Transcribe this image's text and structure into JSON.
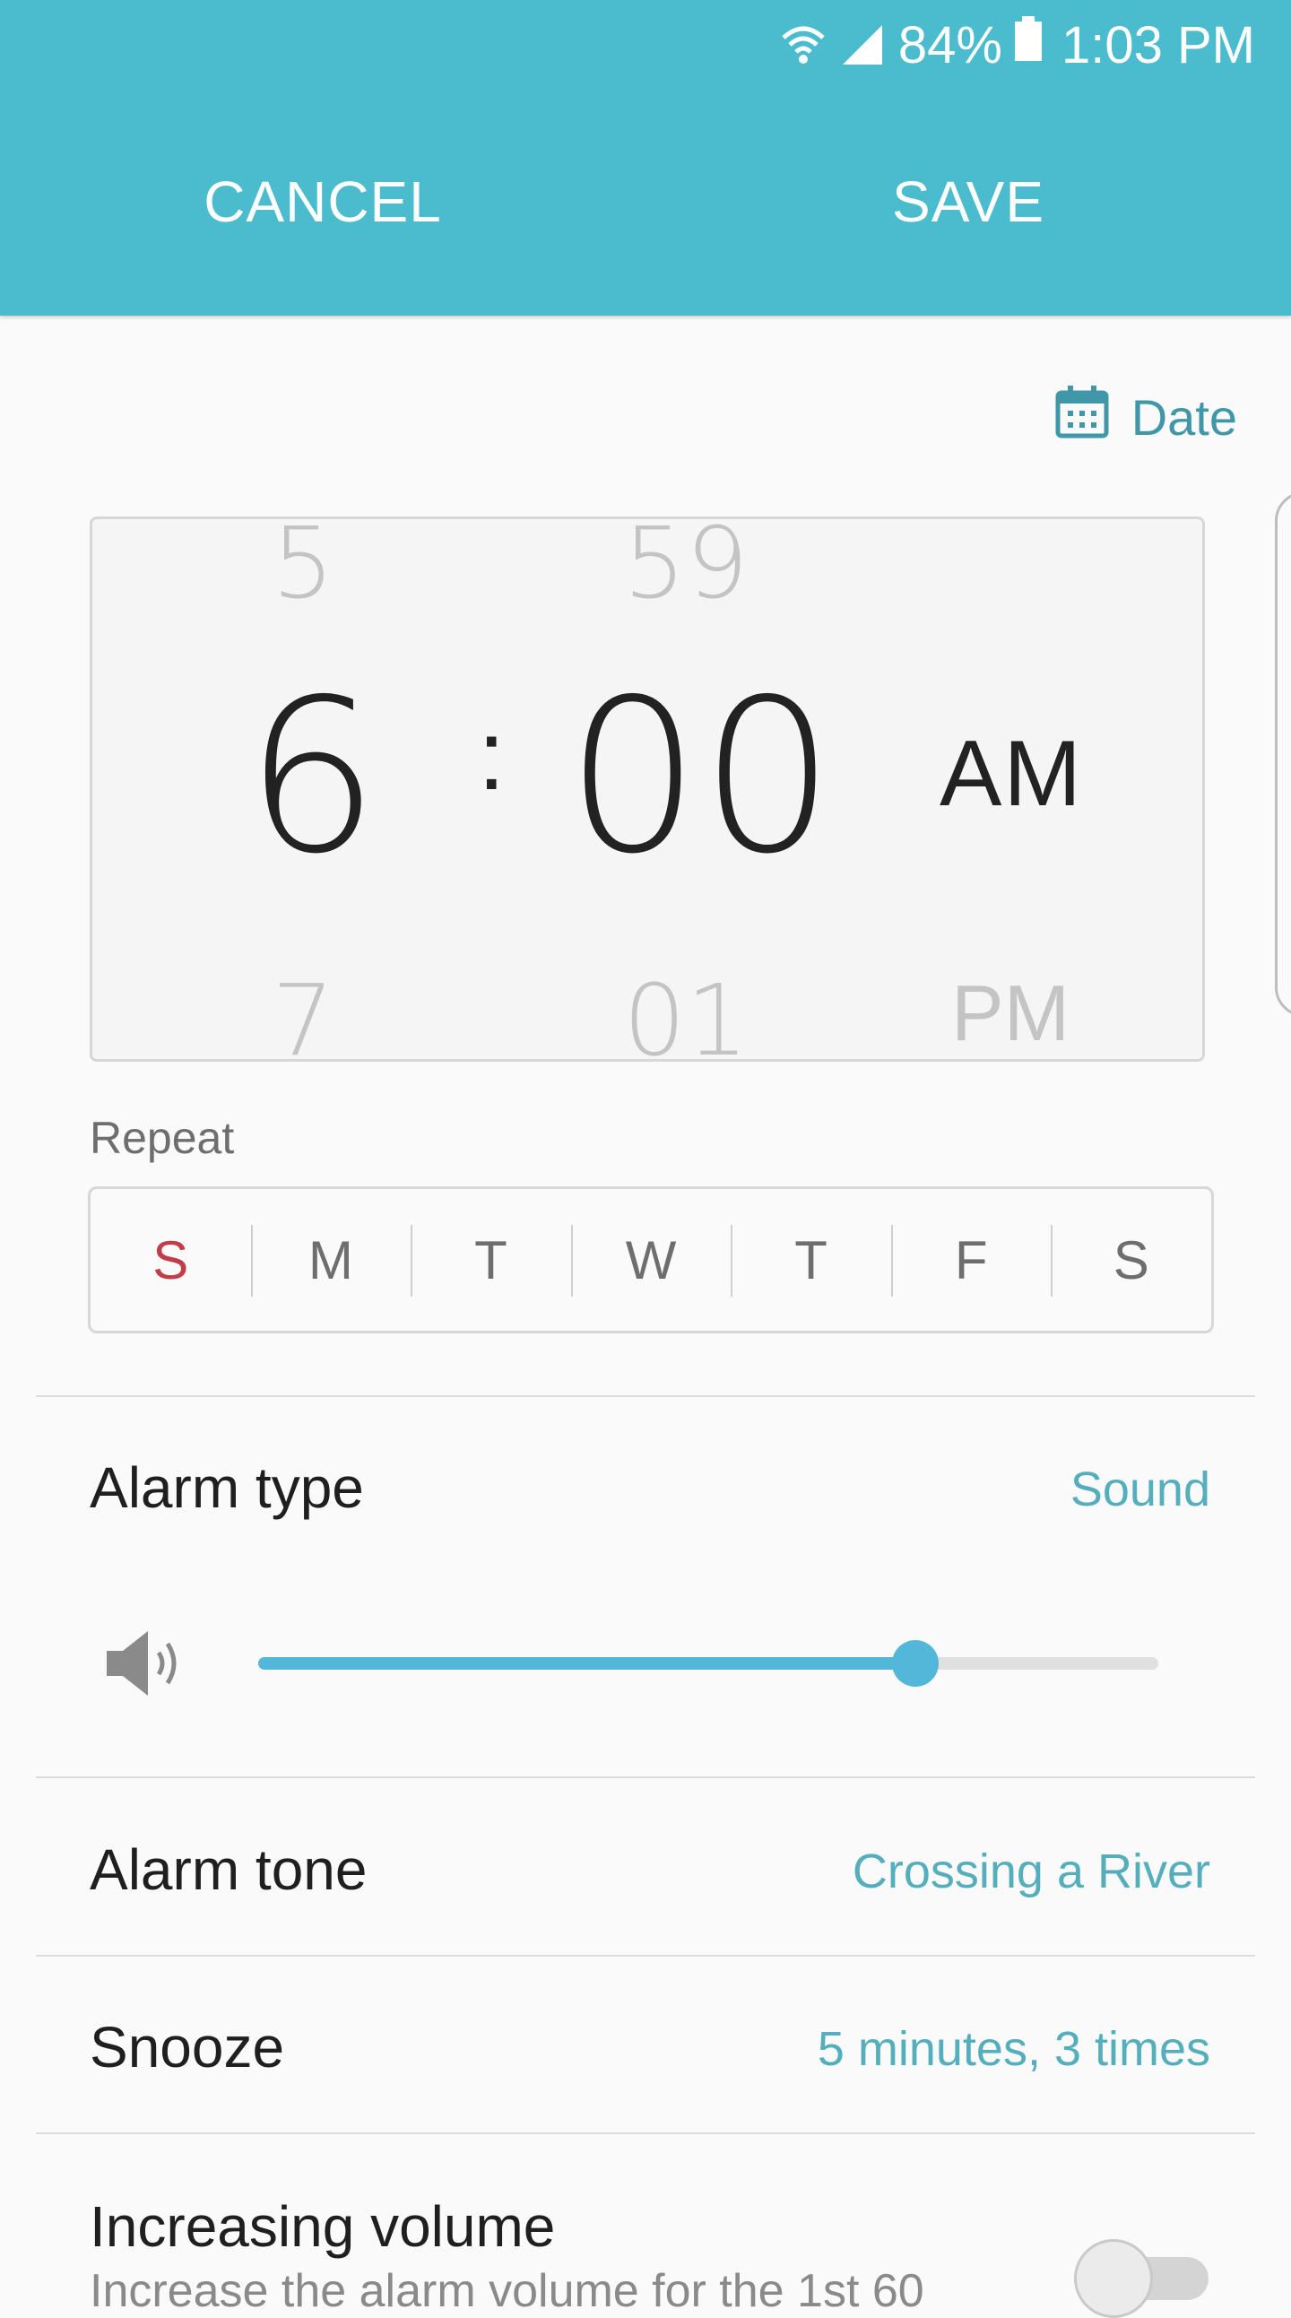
{
  "status_bar": {
    "battery": "84%",
    "time": "1:03 PM",
    "icons": [
      "wifi-icon",
      "signal-icon",
      "battery-icon"
    ]
  },
  "header": {
    "cancel_label": "CANCEL",
    "save_label": "SAVE",
    "background": "#4bbbce"
  },
  "date_link": {
    "label": "Date",
    "icon": "calendar-icon"
  },
  "time_picker": {
    "hour_prev": "5",
    "hour": "6",
    "hour_next": "7",
    "separator": ":",
    "minute_prev": "59",
    "minute": "00",
    "minute_next": "01",
    "period": "AM",
    "period_next": "PM"
  },
  "repeat": {
    "label": "Repeat",
    "days": [
      "S",
      "M",
      "T",
      "W",
      "T",
      "F",
      "S"
    ]
  },
  "alarm_type": {
    "title": "Alarm type",
    "value": "Sound",
    "volume_level": 0.73
  },
  "alarm_tone": {
    "title": "Alarm tone",
    "value": "Crossing a River"
  },
  "snooze": {
    "title": "Snooze",
    "value": "5 minutes, 3 times"
  },
  "increasing_volume": {
    "title": "Increasing volume",
    "subtitle": "Increase the alarm volume for the 1st 60",
    "enabled": false
  },
  "colors": {
    "accent": "#55aebc",
    "sunday": "#c13d48",
    "slider": "#52b7d9"
  }
}
